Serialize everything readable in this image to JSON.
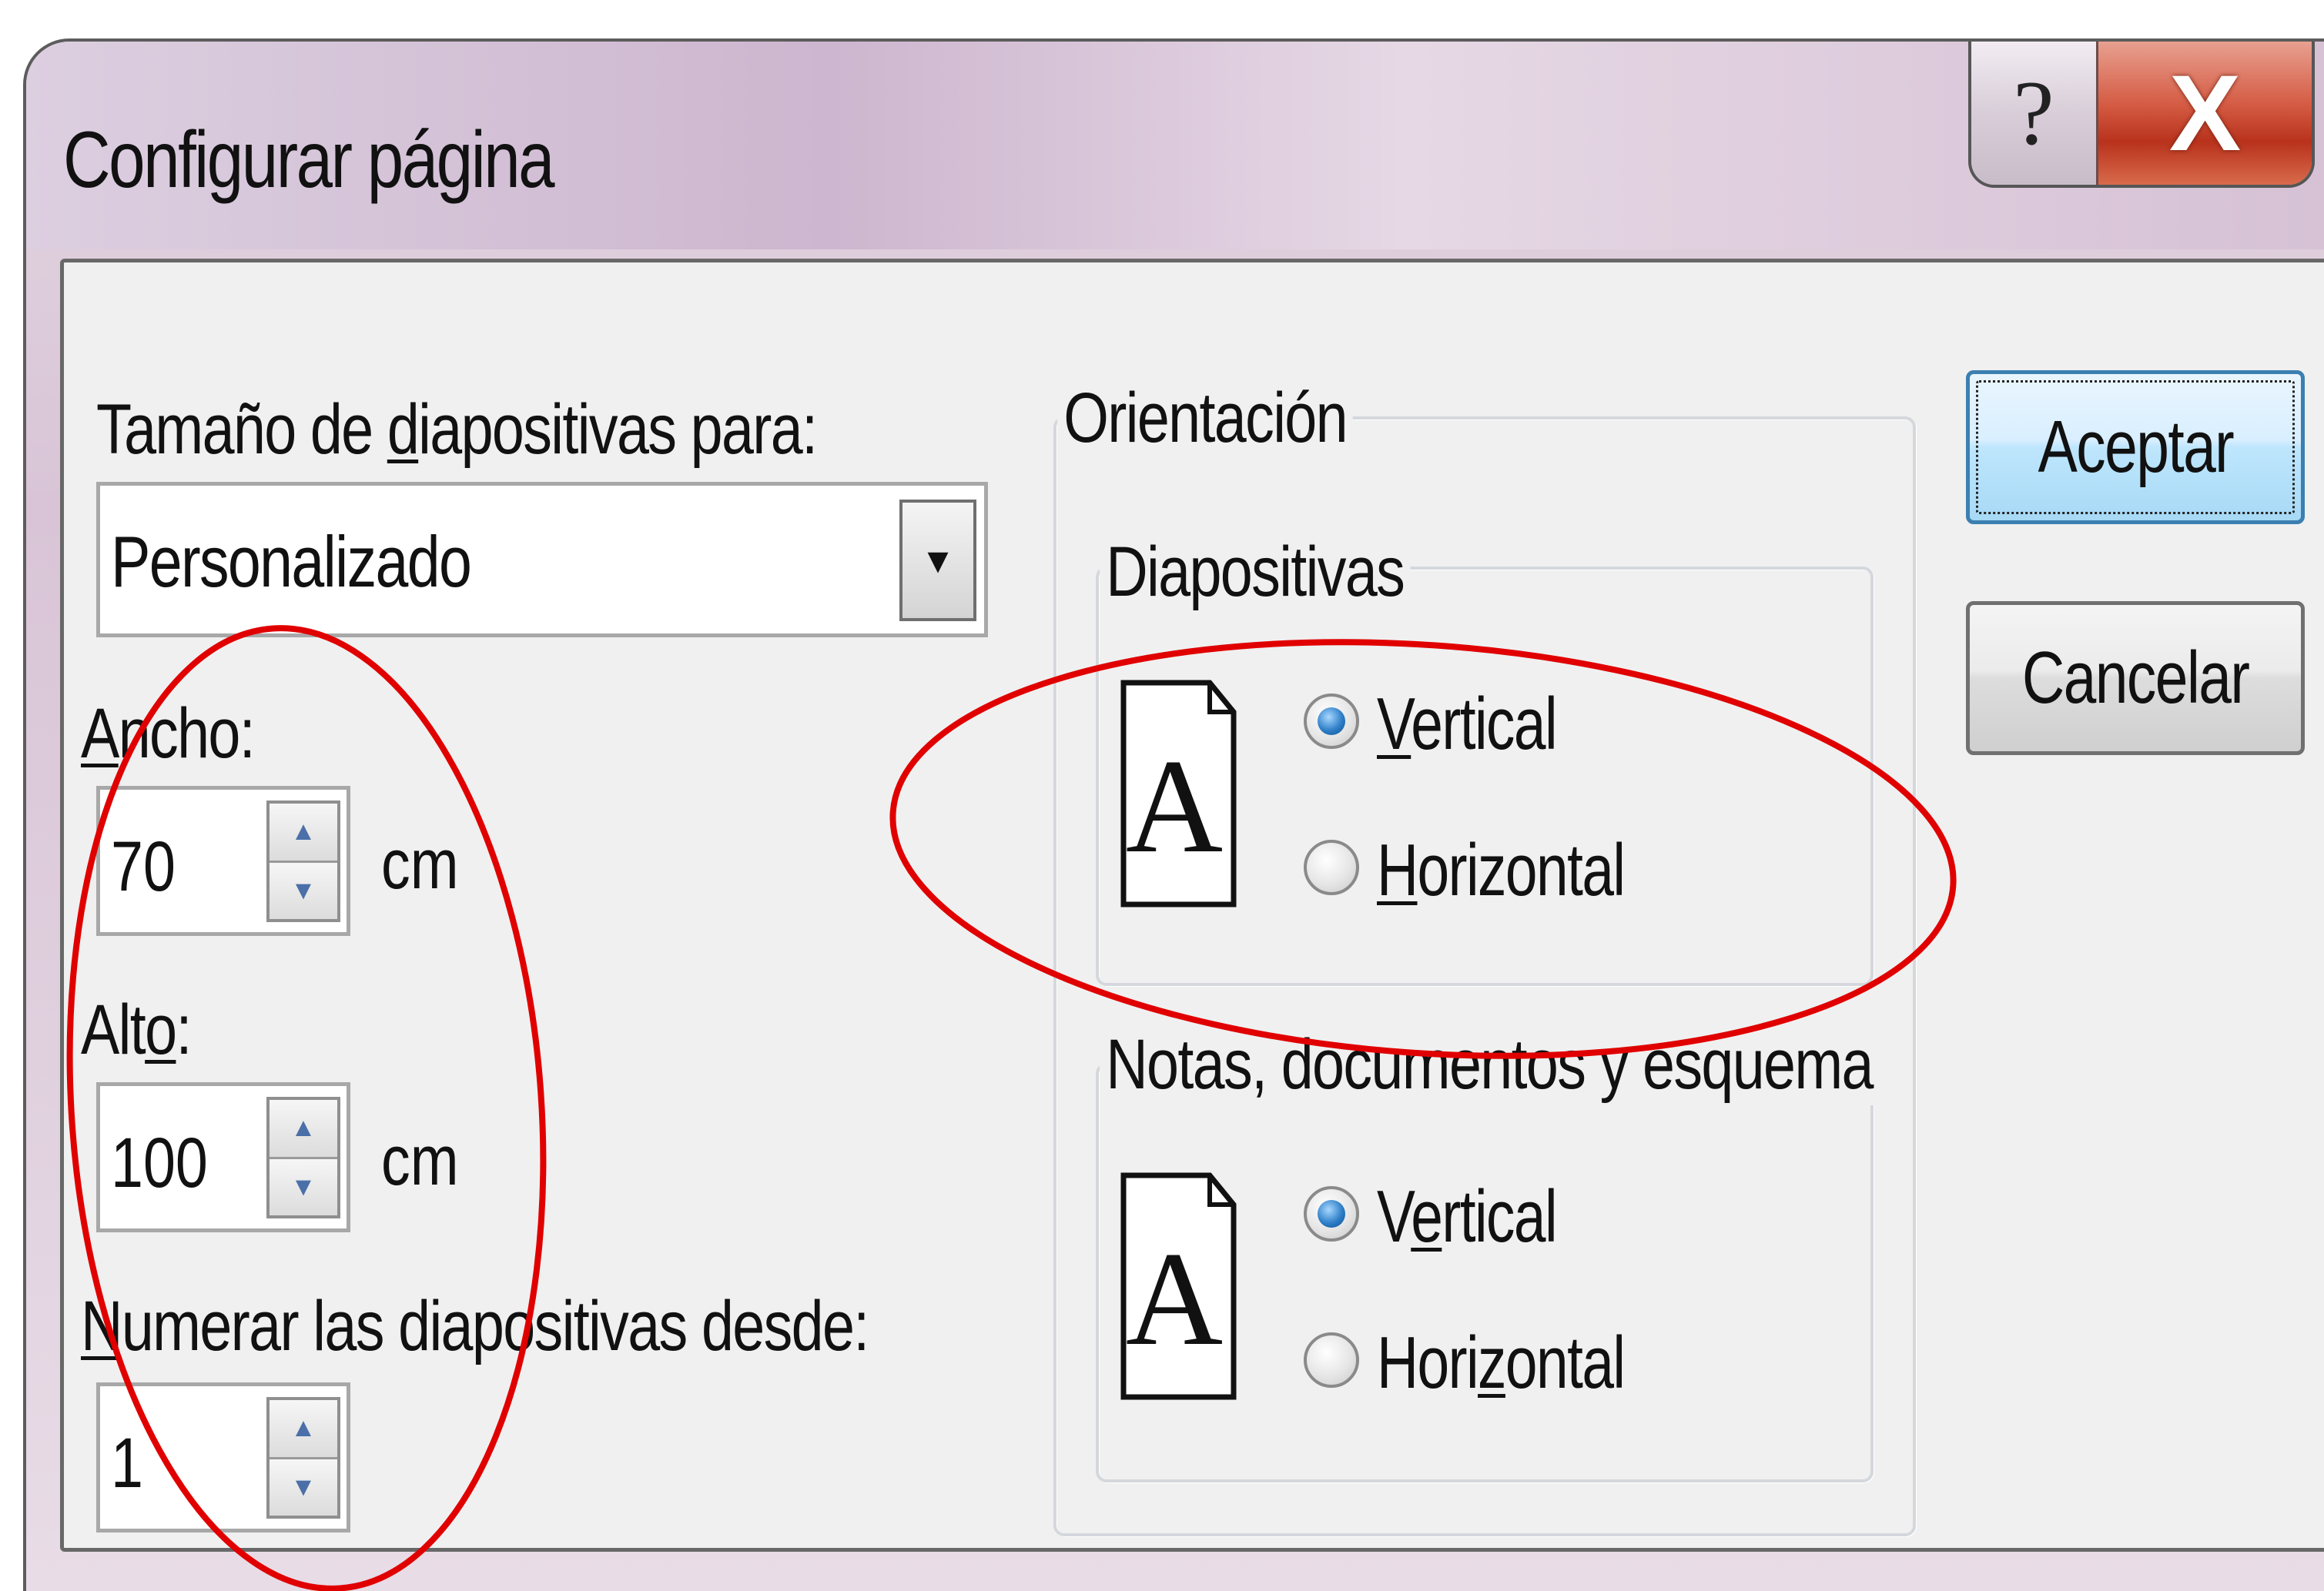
{
  "window": {
    "title": "Configurar página",
    "help_glyph": "?",
    "close_glyph": "X"
  },
  "size": {
    "label_pre": "Tamaño de ",
    "label_key": "d",
    "label_post": "iapositivas para:",
    "selected": "Personalizado"
  },
  "width": {
    "label_key": "A",
    "label_post": "ncho:",
    "value": "70",
    "unit": "cm"
  },
  "height": {
    "label_pre": "Alt",
    "label_key": "o",
    "label_post": ":",
    "value": "100",
    "unit": "cm"
  },
  "numbering": {
    "label_key": "N",
    "label_post": "umerar las diapositivas desde:",
    "value": "1"
  },
  "orientation": {
    "title": "Orientación",
    "slides": {
      "title": "Diapositivas",
      "vertical_key": "V",
      "vertical_post": "ertical",
      "horizontal_key": "H",
      "horizontal_post": "orizontal",
      "selected": "vertical"
    },
    "notes": {
      "title": "Notas, documentos y esquema",
      "vertical_pre": "V",
      "vertical_key": "e",
      "vertical_post": "rtical",
      "horizontal_pre": "Hori",
      "horizontal_key": "z",
      "horizontal_post": "ontal",
      "selected": "vertical"
    },
    "page_glyph": "A"
  },
  "buttons": {
    "ok": "Aceptar",
    "cancel": "Cancelar"
  },
  "colors": {
    "annotation": "#e00000",
    "radio_selected": "#2f7fc8",
    "close_button": "#c8402a"
  }
}
